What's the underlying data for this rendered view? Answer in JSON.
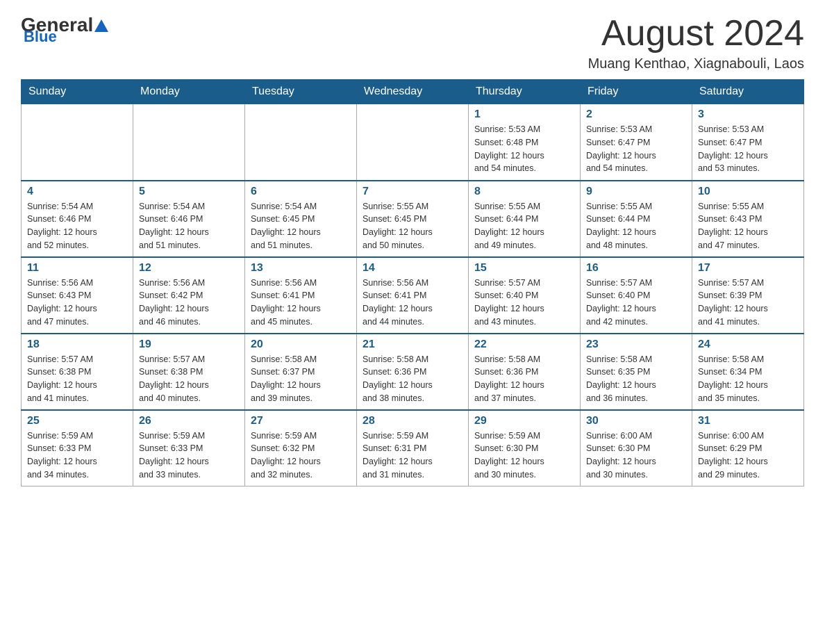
{
  "header": {
    "logo_general": "General",
    "logo_blue": "Blue",
    "month_title": "August 2024",
    "location": "Muang Kenthao, Xiagnabouli, Laos"
  },
  "days_of_week": [
    "Sunday",
    "Monday",
    "Tuesday",
    "Wednesday",
    "Thursday",
    "Friday",
    "Saturday"
  ],
  "weeks": [
    [
      {
        "day": "",
        "info": ""
      },
      {
        "day": "",
        "info": ""
      },
      {
        "day": "",
        "info": ""
      },
      {
        "day": "",
        "info": ""
      },
      {
        "day": "1",
        "info": "Sunrise: 5:53 AM\nSunset: 6:48 PM\nDaylight: 12 hours\nand 54 minutes."
      },
      {
        "day": "2",
        "info": "Sunrise: 5:53 AM\nSunset: 6:47 PM\nDaylight: 12 hours\nand 54 minutes."
      },
      {
        "day": "3",
        "info": "Sunrise: 5:53 AM\nSunset: 6:47 PM\nDaylight: 12 hours\nand 53 minutes."
      }
    ],
    [
      {
        "day": "4",
        "info": "Sunrise: 5:54 AM\nSunset: 6:46 PM\nDaylight: 12 hours\nand 52 minutes."
      },
      {
        "day": "5",
        "info": "Sunrise: 5:54 AM\nSunset: 6:46 PM\nDaylight: 12 hours\nand 51 minutes."
      },
      {
        "day": "6",
        "info": "Sunrise: 5:54 AM\nSunset: 6:45 PM\nDaylight: 12 hours\nand 51 minutes."
      },
      {
        "day": "7",
        "info": "Sunrise: 5:55 AM\nSunset: 6:45 PM\nDaylight: 12 hours\nand 50 minutes."
      },
      {
        "day": "8",
        "info": "Sunrise: 5:55 AM\nSunset: 6:44 PM\nDaylight: 12 hours\nand 49 minutes."
      },
      {
        "day": "9",
        "info": "Sunrise: 5:55 AM\nSunset: 6:44 PM\nDaylight: 12 hours\nand 48 minutes."
      },
      {
        "day": "10",
        "info": "Sunrise: 5:55 AM\nSunset: 6:43 PM\nDaylight: 12 hours\nand 47 minutes."
      }
    ],
    [
      {
        "day": "11",
        "info": "Sunrise: 5:56 AM\nSunset: 6:43 PM\nDaylight: 12 hours\nand 47 minutes."
      },
      {
        "day": "12",
        "info": "Sunrise: 5:56 AM\nSunset: 6:42 PM\nDaylight: 12 hours\nand 46 minutes."
      },
      {
        "day": "13",
        "info": "Sunrise: 5:56 AM\nSunset: 6:41 PM\nDaylight: 12 hours\nand 45 minutes."
      },
      {
        "day": "14",
        "info": "Sunrise: 5:56 AM\nSunset: 6:41 PM\nDaylight: 12 hours\nand 44 minutes."
      },
      {
        "day": "15",
        "info": "Sunrise: 5:57 AM\nSunset: 6:40 PM\nDaylight: 12 hours\nand 43 minutes."
      },
      {
        "day": "16",
        "info": "Sunrise: 5:57 AM\nSunset: 6:40 PM\nDaylight: 12 hours\nand 42 minutes."
      },
      {
        "day": "17",
        "info": "Sunrise: 5:57 AM\nSunset: 6:39 PM\nDaylight: 12 hours\nand 41 minutes."
      }
    ],
    [
      {
        "day": "18",
        "info": "Sunrise: 5:57 AM\nSunset: 6:38 PM\nDaylight: 12 hours\nand 41 minutes."
      },
      {
        "day": "19",
        "info": "Sunrise: 5:57 AM\nSunset: 6:38 PM\nDaylight: 12 hours\nand 40 minutes."
      },
      {
        "day": "20",
        "info": "Sunrise: 5:58 AM\nSunset: 6:37 PM\nDaylight: 12 hours\nand 39 minutes."
      },
      {
        "day": "21",
        "info": "Sunrise: 5:58 AM\nSunset: 6:36 PM\nDaylight: 12 hours\nand 38 minutes."
      },
      {
        "day": "22",
        "info": "Sunrise: 5:58 AM\nSunset: 6:36 PM\nDaylight: 12 hours\nand 37 minutes."
      },
      {
        "day": "23",
        "info": "Sunrise: 5:58 AM\nSunset: 6:35 PM\nDaylight: 12 hours\nand 36 minutes."
      },
      {
        "day": "24",
        "info": "Sunrise: 5:58 AM\nSunset: 6:34 PM\nDaylight: 12 hours\nand 35 minutes."
      }
    ],
    [
      {
        "day": "25",
        "info": "Sunrise: 5:59 AM\nSunset: 6:33 PM\nDaylight: 12 hours\nand 34 minutes."
      },
      {
        "day": "26",
        "info": "Sunrise: 5:59 AM\nSunset: 6:33 PM\nDaylight: 12 hours\nand 33 minutes."
      },
      {
        "day": "27",
        "info": "Sunrise: 5:59 AM\nSunset: 6:32 PM\nDaylight: 12 hours\nand 32 minutes."
      },
      {
        "day": "28",
        "info": "Sunrise: 5:59 AM\nSunset: 6:31 PM\nDaylight: 12 hours\nand 31 minutes."
      },
      {
        "day": "29",
        "info": "Sunrise: 5:59 AM\nSunset: 6:30 PM\nDaylight: 12 hours\nand 30 minutes."
      },
      {
        "day": "30",
        "info": "Sunrise: 6:00 AM\nSunset: 6:30 PM\nDaylight: 12 hours\nand 30 minutes."
      },
      {
        "day": "31",
        "info": "Sunrise: 6:00 AM\nSunset: 6:29 PM\nDaylight: 12 hours\nand 29 minutes."
      }
    ]
  ]
}
